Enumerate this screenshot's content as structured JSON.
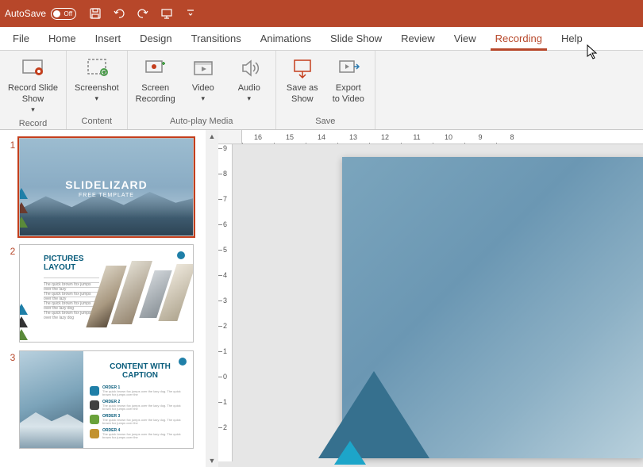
{
  "titlebar": {
    "autosave_label": "AutoSave",
    "autosave_state": "Off"
  },
  "menu": {
    "items": [
      "File",
      "Home",
      "Insert",
      "Design",
      "Transitions",
      "Animations",
      "Slide Show",
      "Review",
      "View",
      "Recording",
      "Help"
    ],
    "active_index": 9
  },
  "ribbon": {
    "groups": [
      {
        "label": "Record",
        "buttons": [
          {
            "label": "Record Slide\nShow",
            "dropdown": true,
            "icon": "record-slide-show-icon"
          }
        ]
      },
      {
        "label": "Content",
        "buttons": [
          {
            "label": "Screenshot",
            "dropdown": true,
            "icon": "screenshot-icon"
          }
        ]
      },
      {
        "label": "Auto-play Media",
        "buttons": [
          {
            "label": "Screen\nRecording",
            "dropdown": false,
            "icon": "screen-recording-icon"
          },
          {
            "label": "Video",
            "dropdown": true,
            "icon": "video-icon"
          },
          {
            "label": "Audio",
            "dropdown": true,
            "icon": "audio-icon"
          }
        ]
      },
      {
        "label": "Save",
        "buttons": [
          {
            "label": "Save as\nShow",
            "dropdown": false,
            "icon": "save-as-show-icon"
          },
          {
            "label": "Export\nto Video",
            "dropdown": false,
            "icon": "export-video-icon"
          }
        ]
      }
    ]
  },
  "slides": [
    {
      "num": "1",
      "title": "SLIDELIZARD",
      "subtitle": "FREE TEMPLATE"
    },
    {
      "num": "2",
      "title": "PICTURES\nLAYOUT"
    },
    {
      "num": "3",
      "title": "CONTENT WITH\nCAPTION",
      "rows": [
        {
          "color": "#1f7fa8",
          "h": "ORDER 1"
        },
        {
          "color": "#404040",
          "h": "ORDER 2"
        },
        {
          "color": "#6aa23a",
          "h": "ORDER 3"
        },
        {
          "color": "#c2922e",
          "h": "ORDER 4"
        }
      ]
    }
  ],
  "ruler_h": [
    "16",
    "15",
    "14",
    "13",
    "12",
    "11",
    "10",
    "9",
    "8"
  ],
  "ruler_v": [
    "9",
    "8",
    "7",
    "6",
    "5",
    "4",
    "3",
    "2",
    "1",
    "0",
    "1",
    "2"
  ],
  "colors": {
    "accent": "#b7472a"
  }
}
